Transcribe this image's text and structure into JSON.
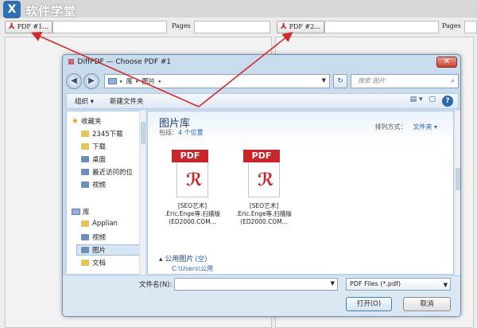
{
  "app": {
    "logo": "X",
    "brand": "软件学堂",
    "left": {
      "pdf_button": "PDF #1...",
      "pages_label": "Pages"
    },
    "right": {
      "pdf_button": "PDF #2...",
      "pages_label": "Pages"
    }
  },
  "dialog": {
    "icon": "DiffPDF-icon",
    "title": "DiffPDF — Choose PDF #1",
    "close": "✕",
    "address": {
      "crumbs": [
        "库",
        "图片"
      ]
    },
    "search_placeholder": "搜索 图片",
    "toolbar": {
      "organize": "组织 ▾",
      "new_folder": "新建文件夹"
    },
    "sidebar": {
      "favorites": "收藏夹",
      "favorite_items": [
        "2345下载",
        "下载",
        "桌面",
        "最近访问的位",
        "视频"
      ],
      "libraries": "库",
      "library_items": [
        "Applian",
        "视频",
        "图片",
        "文档"
      ]
    },
    "library": {
      "title": "图片库",
      "sub_prefix": "包括：",
      "sub_link": "4 个位置",
      "arrange_label": "排列方式：",
      "arrange_value": "文件夹 ▾"
    },
    "files": [
      {
        "band": "PDF",
        "name": "[SEO艺术]\n.Eric.Enge等.扫描版\n(ED2000.COM..."
      },
      {
        "band": "PDF",
        "name": "[SEO艺术]\n.Eric.Enge等.扫描版\n(ED2000.COM..."
      }
    ],
    "public_group": "公用图片",
    "public_group_extra": "(空)",
    "public_path": "C:\\Users\\公用",
    "filename_label": "文件名(N):",
    "filename_value": "",
    "filetype": "PDF Files (*.pdf)",
    "open_button": "打开(O)",
    "cancel_button": "取消"
  },
  "colors": {
    "accent": "#2a63b4",
    "pdf_red": "#c8262b",
    "arrow": "#d22a2a"
  }
}
